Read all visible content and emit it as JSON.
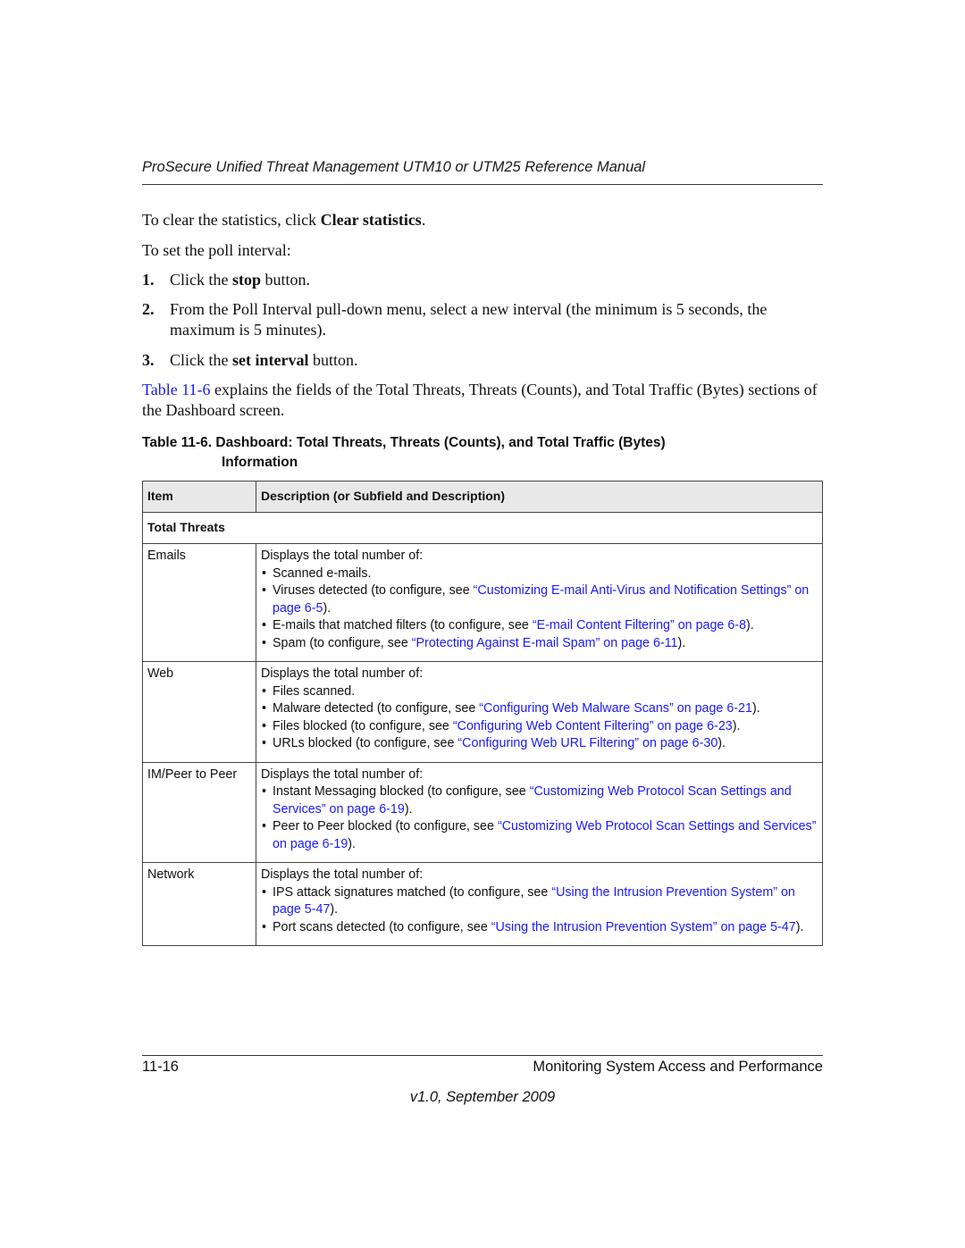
{
  "header": {
    "title": "ProSecure Unified Threat Management UTM10 or UTM25 Reference Manual"
  },
  "body": {
    "clear_stats": {
      "prefix": "To clear the statistics, click ",
      "bold": "Clear statistics",
      "suffix": "."
    },
    "poll_intro": "To set the poll interval:",
    "steps": [
      {
        "num": "1.",
        "prefix": "Click the ",
        "bold": "stop",
        "suffix": " button."
      },
      {
        "num": "2.",
        "prefix": "From the Poll Interval pull-down menu, select a new interval (the minimum is 5 seconds, the maximum is 5 minutes).",
        "bold": "",
        "suffix": ""
      },
      {
        "num": "3.",
        "prefix": "Click the ",
        "bold": "set interval",
        "suffix": " button."
      }
    ],
    "table_ref": {
      "link": "Table 11-6",
      "text": " explains the fields of the Total Threats, Threats (Counts), and Total Traffic (Bytes) sections of the Dashboard screen."
    }
  },
  "table": {
    "caption_line1": "Table 11-6. Dashboard: Total Threats, Threats (Counts), and Total Traffic (Bytes)",
    "caption_line2": "Information",
    "headers": [
      "Item",
      "Description (or Subfield and Description)"
    ],
    "section": "Total Threats",
    "rows": [
      {
        "item": "Emails",
        "intro": "Displays the total number of:",
        "bullets": [
          {
            "text": "Scanned e-mails.",
            "link": "",
            "after": ""
          },
          {
            "text": "Viruses detected (to configure, see ",
            "link": "“Customizing E-mail Anti-Virus and Notification Settings” on page 6-5",
            "after": ")."
          },
          {
            "text": "E-mails that matched filters (to configure, see ",
            "link": "“E-mail Content Filtering” on page 6-8",
            "after": ")."
          },
          {
            "text": "Spam (to configure, see ",
            "link": "“Protecting Against E-mail Spam” on page 6-11",
            "after": ")."
          }
        ]
      },
      {
        "item": "Web",
        "intro": "Displays the total number of:",
        "bullets": [
          {
            "text": "Files scanned.",
            "link": "",
            "after": ""
          },
          {
            "text": "Malware detected (to configure, see ",
            "link": "“Configuring Web Malware Scans” on page 6-21",
            "after": ")."
          },
          {
            "text": "Files blocked (to configure, see ",
            "link": "“Configuring Web Content Filtering” on page 6-23",
            "after": ")."
          },
          {
            "text": "URLs blocked (to configure, see ",
            "link": "“Configuring Web URL Filtering” on page 6-30",
            "after": ")."
          }
        ]
      },
      {
        "item": "IM/Peer to Peer",
        "intro": "Displays the total number of:",
        "bullets": [
          {
            "text": "Instant Messaging blocked (to configure, see ",
            "link": "“Customizing Web Protocol Scan Settings and Services” on page 6-19",
            "after": ")."
          },
          {
            "text": "Peer to Peer blocked (to configure, see ",
            "link": "“Customizing Web Protocol Scan Settings and Services” on page 6-19",
            "after": ")."
          }
        ]
      },
      {
        "item": "Network",
        "intro": "Displays the total number of:",
        "bullets": [
          {
            "text": "IPS attack signatures matched (to configure, see ",
            "link": "“Using the Intrusion Prevention System” on page 5-47",
            "after": ")."
          },
          {
            "text": "Port scans detected (to configure, see ",
            "link": "“Using the Intrusion Prevention System” on page 5-47",
            "after": ")."
          }
        ]
      }
    ]
  },
  "footer": {
    "page_number": "11-16",
    "chapter": "Monitoring System Access and Performance",
    "version": "v1.0, September 2009"
  },
  "colors": {
    "link": "#1a1aff",
    "header_fill": "#e8e8e8"
  }
}
